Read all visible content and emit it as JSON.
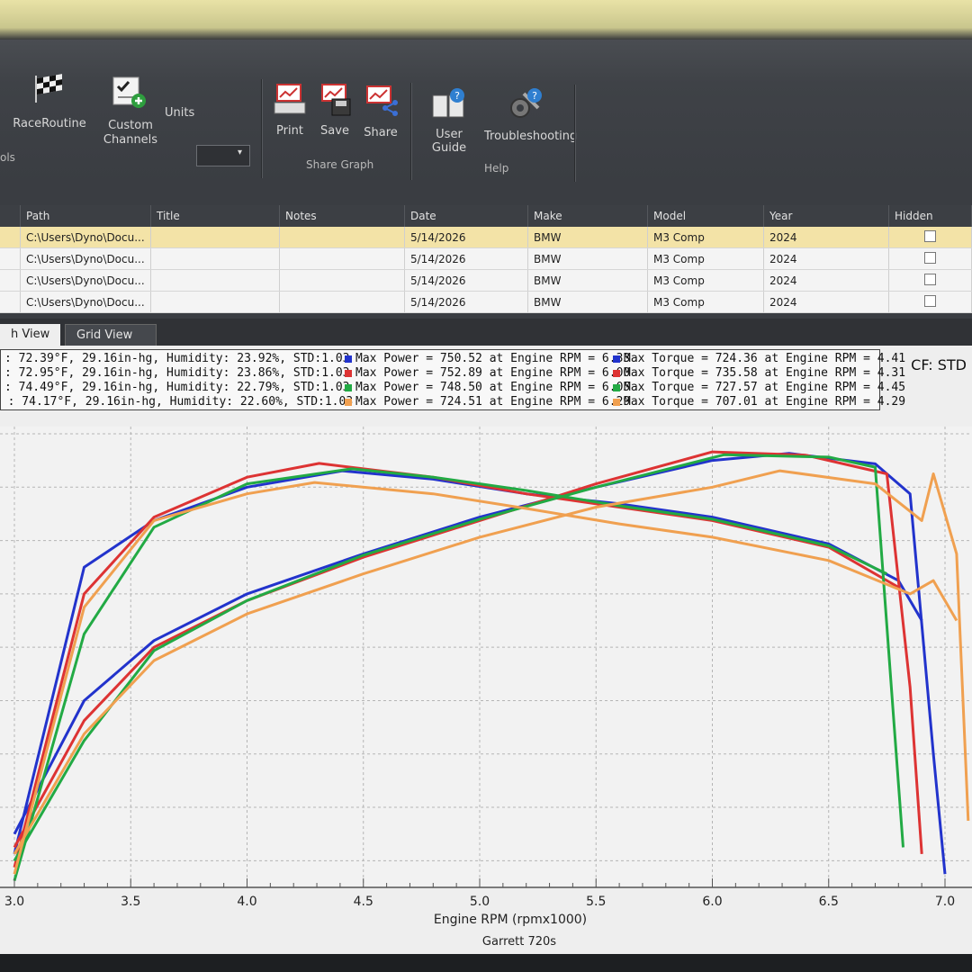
{
  "ribbon": {
    "items": [
      {
        "label": "RaceRoutine",
        "icon": "checkered-flag-icon"
      },
      {
        "label": "Custom\nChannels",
        "icon": "custom-channels-icon"
      },
      {
        "label": "Print",
        "icon": "print-icon"
      },
      {
        "label": "Save",
        "icon": "save-icon"
      },
      {
        "label": "Share",
        "icon": "share-icon"
      },
      {
        "label": "User Guide",
        "icon": "user-guide-icon"
      },
      {
        "label": "Troubleshooting",
        "icon": "troubleshooting-icon"
      }
    ],
    "units_label": "Units",
    "units_value": "",
    "groups": {
      "tools": "ols",
      "share_graph": "Share Graph",
      "help": "Help"
    }
  },
  "grid": {
    "columns": [
      "Path",
      "Title",
      "Notes",
      "Date",
      "Make",
      "Model",
      "Year",
      "Hidden"
    ],
    "rows": [
      {
        "path": "C:\\Users\\Dyno\\Docu...",
        "title": "",
        "notes": "",
        "date": "5/14/2026",
        "make": "BMW",
        "model": "M3 Comp",
        "year": "2024"
      },
      {
        "path": "C:\\Users\\Dyno\\Docu...",
        "title": "",
        "notes": "",
        "date": "5/14/2026",
        "make": "BMW",
        "model": "M3 Comp",
        "year": "2024"
      },
      {
        "path": "C:\\Users\\Dyno\\Docu...",
        "title": "",
        "notes": "",
        "date": "5/14/2026",
        "make": "BMW",
        "model": "M3 Comp",
        "year": "2024"
      },
      {
        "path": "C:\\Users\\Dyno\\Docu...",
        "title": "",
        "notes": "",
        "date": "5/14/2026",
        "make": "BMW",
        "model": "M3 Comp",
        "year": "2024"
      }
    ]
  },
  "tabs": {
    "graph_view": "h View",
    "grid_view": "Grid View"
  },
  "legend": {
    "rows": [
      {
        "cond": ": 72.39°F, 29.16in-hg, Humidity: 23.92%, STD:1.03",
        "power": "Max Power = 750.52 at Engine RPM = 6.33",
        "torque": "Max Torque = 724.36 at Engine RPM = 4.41",
        "color": "#2233cc"
      },
      {
        "cond": ": 72.95°F, 29.16in-hg, Humidity: 23.86%, STD:1.03",
        "power": "Max Power = 752.89 at Engine RPM = 6.00",
        "torque": "Max Torque = 735.58 at Engine RPM = 4.31",
        "color": "#dd3333"
      },
      {
        "cond": ": 74.49°F, 29.16in-hg, Humidity: 22.79%, STD:1.03",
        "power": "Max Power = 748.50 at Engine RPM = 6.05",
        "torque": "Max Torque = 727.57 at Engine RPM = 4.45",
        "color": "#22aa44"
      },
      {
        "cond": "8 : 74.17°F, 29.16in-hg, Humidity: 22.60%, STD:1.03",
        "power": "Max Power = 724.51 at Engine RPM = 6.29",
        "torque": "Max Torque = 707.01 at Engine RPM = 4.29",
        "color": "#f0a050"
      }
    ],
    "cf": "CF: STD"
  },
  "chart_data": {
    "type": "line",
    "xlabel": "Engine RPM (rpmx1000)",
    "footer": "Garrett 720s",
    "x_ticks": [
      "3.0",
      "3.5",
      "4.0",
      "4.5",
      "5.0",
      "5.5",
      "6.0",
      "6.5",
      "7.0"
    ],
    "xlim": [
      3.0,
      7.0
    ],
    "series": [
      {
        "color": "#2233cc",
        "power": [
          [
            3.0,
            180
          ],
          [
            3.3,
            380
          ],
          [
            3.6,
            470
          ],
          [
            4.0,
            540
          ],
          [
            4.5,
            600
          ],
          [
            5.0,
            655
          ],
          [
            5.5,
            700
          ],
          [
            6.0,
            740
          ],
          [
            6.33,
            750.52
          ],
          [
            6.7,
            735
          ],
          [
            6.85,
            690
          ],
          [
            6.95,
            300
          ],
          [
            7.0,
            120
          ]
        ],
        "torque": [
          [
            3.0,
            150
          ],
          [
            3.3,
            580
          ],
          [
            3.6,
            650
          ],
          [
            4.0,
            700
          ],
          [
            4.41,
            724.36
          ],
          [
            4.8,
            712
          ],
          [
            5.2,
            690
          ],
          [
            5.6,
            675
          ],
          [
            6.0,
            655
          ],
          [
            6.5,
            615
          ],
          [
            6.8,
            560
          ],
          [
            6.9,
            500
          ]
        ]
      },
      {
        "color": "#dd3333",
        "power": [
          [
            3.0,
            160
          ],
          [
            3.3,
            350
          ],
          [
            3.6,
            460
          ],
          [
            4.0,
            530
          ],
          [
            4.5,
            595
          ],
          [
            5.0,
            650
          ],
          [
            5.5,
            705
          ],
          [
            6.0,
            752.89
          ],
          [
            6.4,
            748
          ],
          [
            6.75,
            720
          ],
          [
            6.85,
            400
          ],
          [
            6.9,
            150
          ]
        ],
        "torque": [
          [
            3.0,
            130
          ],
          [
            3.3,
            540
          ],
          [
            3.6,
            655
          ],
          [
            4.0,
            715
          ],
          [
            4.31,
            735.58
          ],
          [
            4.8,
            715
          ],
          [
            5.2,
            690
          ],
          [
            5.6,
            670
          ],
          [
            6.0,
            650
          ],
          [
            6.5,
            610
          ],
          [
            6.8,
            550
          ]
        ]
      },
      {
        "color": "#22aa44",
        "power": [
          [
            3.0,
            140
          ],
          [
            3.3,
            320
          ],
          [
            3.6,
            455
          ],
          [
            4.0,
            530
          ],
          [
            4.5,
            598
          ],
          [
            5.0,
            652
          ],
          [
            5.5,
            700
          ],
          [
            6.05,
            748.5
          ],
          [
            6.5,
            745
          ],
          [
            6.7,
            730
          ],
          [
            6.78,
            350
          ],
          [
            6.82,
            160
          ]
        ],
        "torque": [
          [
            3.0,
            110
          ],
          [
            3.3,
            480
          ],
          [
            3.6,
            640
          ],
          [
            4.0,
            705
          ],
          [
            4.45,
            727.57
          ],
          [
            4.8,
            715
          ],
          [
            5.2,
            695
          ],
          [
            5.6,
            672
          ],
          [
            6.0,
            652
          ],
          [
            6.5,
            612
          ],
          [
            6.75,
            570
          ]
        ]
      },
      {
        "color": "#f0a050",
        "power": [
          [
            3.0,
            150
          ],
          [
            3.3,
            330
          ],
          [
            3.6,
            440
          ],
          [
            4.0,
            510
          ],
          [
            4.5,
            570
          ],
          [
            5.0,
            625
          ],
          [
            5.5,
            670
          ],
          [
            6.0,
            700
          ],
          [
            6.29,
            724.51
          ],
          [
            6.7,
            705
          ],
          [
            6.9,
            650
          ],
          [
            6.95,
            720
          ],
          [
            7.05,
            600
          ],
          [
            7.1,
            200
          ]
        ],
        "torque": [
          [
            3.0,
            120
          ],
          [
            3.3,
            520
          ],
          [
            3.6,
            650
          ],
          [
            4.0,
            690
          ],
          [
            4.29,
            707.01
          ],
          [
            4.8,
            690
          ],
          [
            5.2,
            668
          ],
          [
            5.6,
            645
          ],
          [
            6.0,
            625
          ],
          [
            6.5,
            590
          ],
          [
            6.85,
            540
          ],
          [
            6.95,
            560
          ],
          [
            7.05,
            500
          ]
        ]
      }
    ]
  }
}
